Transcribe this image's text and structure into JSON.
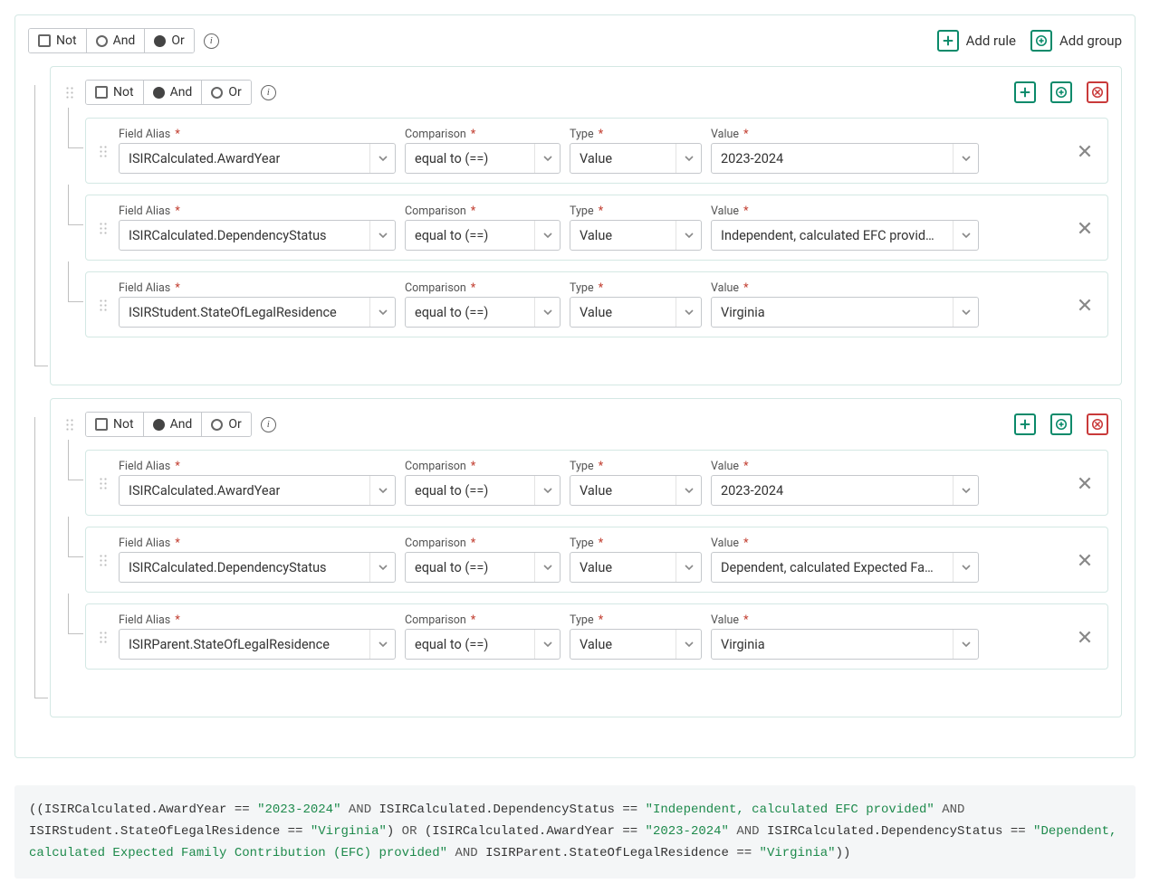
{
  "labels": {
    "not": "Not",
    "and": "And",
    "or": "Or",
    "add_rule": "Add rule",
    "add_group": "Add group",
    "field_alias": "Field Alias",
    "comparison": "Comparison",
    "type": "Type",
    "value": "Value",
    "required_mark": "*",
    "info": "i"
  },
  "root": {
    "not": false,
    "op": "Or",
    "groups": [
      {
        "not": false,
        "op": "And",
        "rules": [
          {
            "alias": "ISIRCalculated.AwardYear",
            "comparison": "equal to (==)",
            "type": "Value",
            "value": "2023-2024"
          },
          {
            "alias": "ISIRCalculated.DependencyStatus",
            "comparison": "equal to (==)",
            "type": "Value",
            "value": "Independent, calculated EFC provid…"
          },
          {
            "alias": "ISIRStudent.StateOfLegalResidence",
            "comparison": "equal to (==)",
            "type": "Value",
            "value": "Virginia"
          }
        ]
      },
      {
        "not": false,
        "op": "And",
        "rules": [
          {
            "alias": "ISIRCalculated.AwardYear",
            "comparison": "equal to (==)",
            "type": "Value",
            "value": "2023-2024"
          },
          {
            "alias": "ISIRCalculated.DependencyStatus",
            "comparison": "equal to (==)",
            "type": "Value",
            "value": "Dependent, calculated Expected Fa…"
          },
          {
            "alias": "ISIRParent.StateOfLegalResidence",
            "comparison": "equal to (==)",
            "type": "Value",
            "value": "Virginia"
          }
        ]
      }
    ]
  },
  "expression": {
    "tokens": [
      {
        "t": "op",
        "v": "(("
      },
      {
        "t": "id",
        "v": "ISIRCalculated.AwardYear"
      },
      {
        "t": "op",
        "v": " == "
      },
      {
        "t": "str",
        "v": "\"2023-2024\""
      },
      {
        "t": "kw",
        "v": " AND "
      },
      {
        "t": "id",
        "v": "ISIRCalculated.DependencyStatus"
      },
      {
        "t": "op",
        "v": " == "
      },
      {
        "t": "str",
        "v": "\"Independent, calculated EFC provided\""
      },
      {
        "t": "kw",
        "v": " AND "
      },
      {
        "t": "id",
        "v": "ISIRStudent.StateOfLegalResidence"
      },
      {
        "t": "op",
        "v": " == "
      },
      {
        "t": "str",
        "v": "\"Virginia\""
      },
      {
        "t": "op",
        "v": ")"
      },
      {
        "t": "kw",
        "v": " OR "
      },
      {
        "t": "op",
        "v": "("
      },
      {
        "t": "id",
        "v": "ISIRCalculated.AwardYear"
      },
      {
        "t": "op",
        "v": " == "
      },
      {
        "t": "str",
        "v": "\"2023-2024\""
      },
      {
        "t": "kw",
        "v": " AND "
      },
      {
        "t": "id",
        "v": "ISIRCalculated.DependencyStatus"
      },
      {
        "t": "op",
        "v": " == "
      },
      {
        "t": "str",
        "v": "\"Dependent, calculated Expected Family Contribution (EFC) provided\""
      },
      {
        "t": "kw",
        "v": " AND "
      },
      {
        "t": "id",
        "v": "ISIRParent.StateOfLegalResidence"
      },
      {
        "t": "op",
        "v": " == "
      },
      {
        "t": "str",
        "v": "\"Virginia\""
      },
      {
        "t": "op",
        "v": "))"
      }
    ]
  }
}
